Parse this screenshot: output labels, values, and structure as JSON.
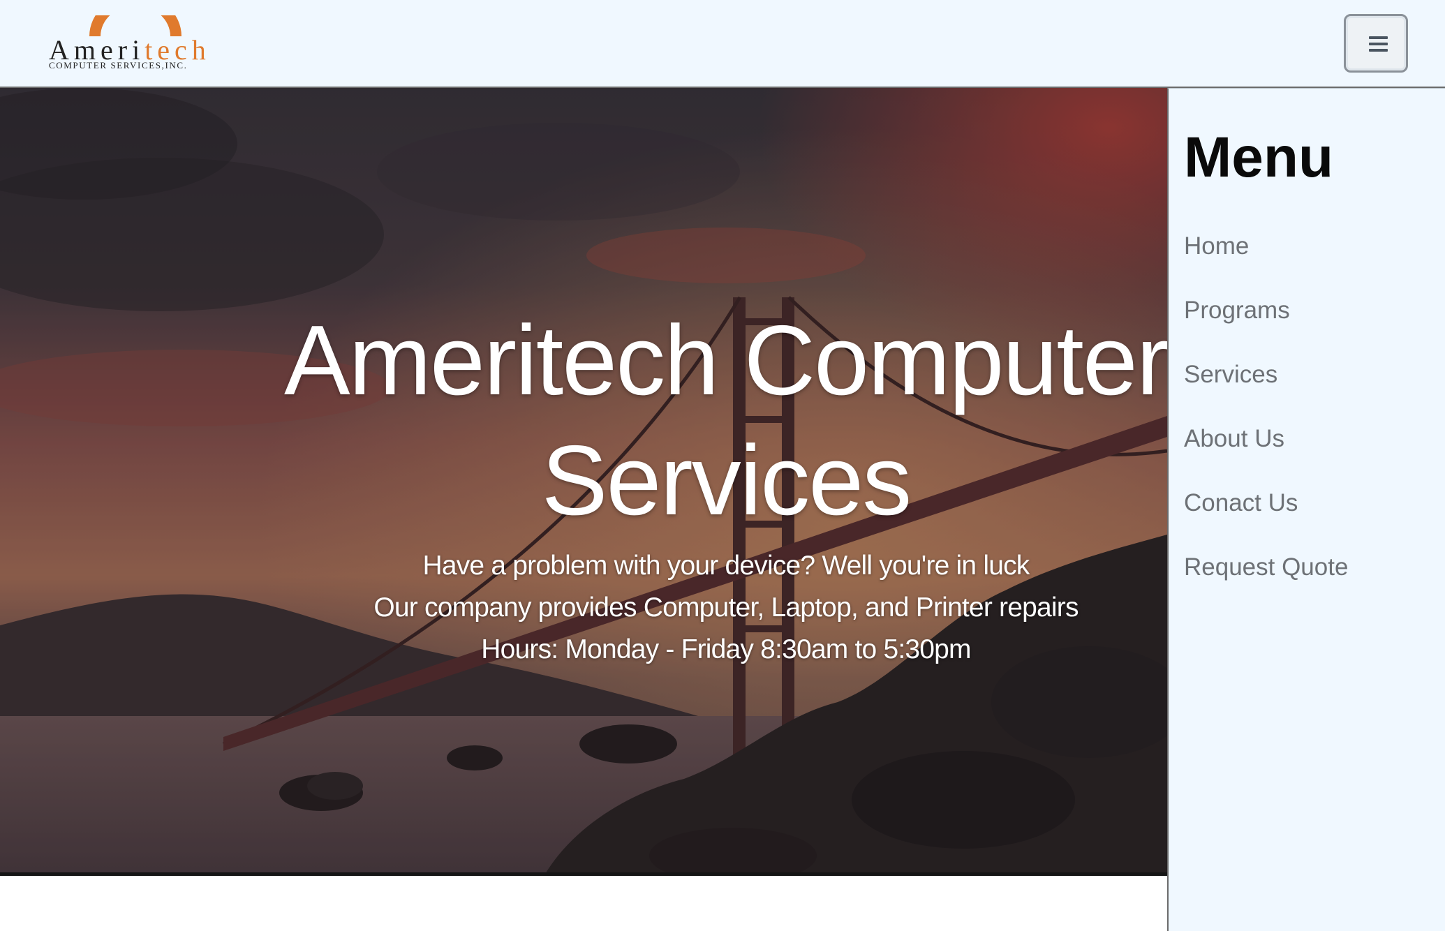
{
  "navbar": {
    "logo": {
      "word_dark": "Ameri",
      "word_orange": "tech",
      "subtitle": "COMPUTER SERVICES,INC."
    },
    "toggler_icon": "hamburger-icon"
  },
  "hero": {
    "title": "Ameritech Computer Services",
    "lines": [
      "Have a problem with your device? Well you're in luck",
      "Our company provides Computer, Laptop, and Printer repairs",
      "Hours: Monday - Friday 8:30am to 5:30pm"
    ],
    "background": "sunset-golden-gate-bridge-photo"
  },
  "sidemenu": {
    "title": "Menu",
    "items": [
      {
        "label": "Home"
      },
      {
        "label": "Programs"
      },
      {
        "label": "Services"
      },
      {
        "label": "About Us"
      },
      {
        "label": "Conact Us"
      },
      {
        "label": "Request Quote"
      }
    ]
  },
  "colors": {
    "navbar_bg": "#f0f8ff",
    "logo_orange": "#e07a2d",
    "menu_text": "#6d7176",
    "hero_text": "#ffffff"
  }
}
